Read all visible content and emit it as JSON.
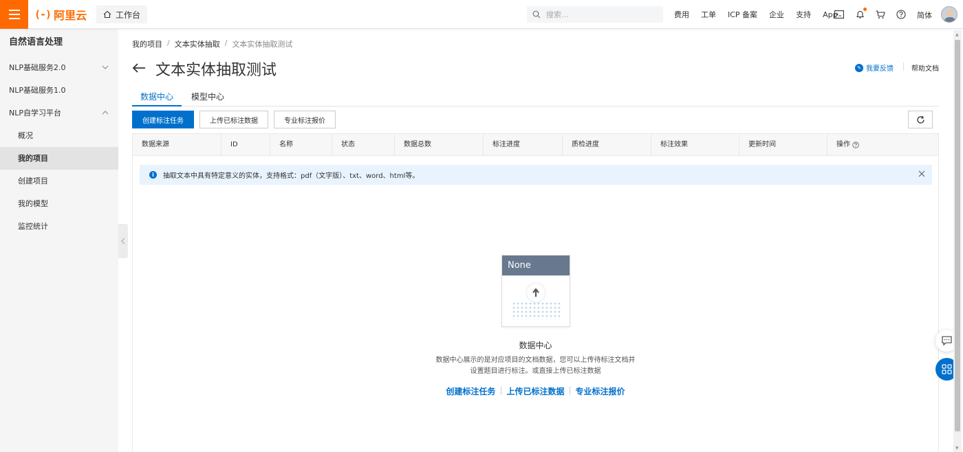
{
  "topbar": {
    "logo_mark": "(-)",
    "logo_text": "阿里云",
    "workbench": "工作台",
    "search_placeholder": "搜索...",
    "links": [
      "费用",
      "工单",
      "ICP 备案",
      "企业",
      "支持",
      "App"
    ],
    "lang": "简体"
  },
  "sidebar": {
    "title": "自然语言处理",
    "items": [
      {
        "label": "NLP基础服务2.0",
        "chevron": "down"
      },
      {
        "label": "NLP基础服务1.0"
      },
      {
        "label": "NLP自学习平台",
        "chevron": "up"
      }
    ],
    "subitems": [
      "概况",
      "我的项目",
      "创建项目",
      "我的模型",
      "监控统计"
    ],
    "active": "我的项目"
  },
  "breadcrumb": [
    "我的项目",
    "文本实体抽取",
    "文本实体抽取测试"
  ],
  "page_title": "文本实体抽取测试",
  "header_links": {
    "feedback": "我要反馈",
    "help": "帮助文档"
  },
  "tabs": [
    "数据中心",
    "模型中心"
  ],
  "toolbar": {
    "create": "创建标注任务",
    "upload": "上传已标注数据",
    "quote": "专业标注报价"
  },
  "table": {
    "columns": [
      "数据来源",
      "ID",
      "名称",
      "状态",
      "数据总数",
      "标注进度",
      "质检进度",
      "标注效果",
      "更新时间",
      "操作"
    ]
  },
  "alert": {
    "text": "抽取文本中具有特定意义的实体，支持格式：pdf（文字版）、txt、word、html等。"
  },
  "empty": {
    "card_header": "None",
    "title": "数据中心",
    "desc_line1": "数据中心展示的是对应项目的文档数据，您可以上传待标注文档并",
    "desc_line2": "设置题目进行标注。或直接上传已标注数据",
    "links": [
      "创建标注任务",
      "上传已标注数据",
      "专业标注报价"
    ]
  },
  "colors": {
    "brand": "#ff6a00",
    "primary": "#0070cc"
  }
}
